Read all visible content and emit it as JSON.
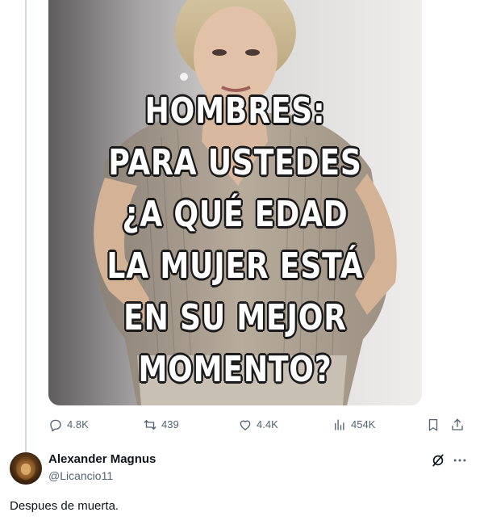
{
  "meme": {
    "lines": [
      "HOMBRES:",
      "PARA USTEDES",
      "¿A QUÉ EDAD",
      "LA MUJER ESTÁ",
      "EN SU MEJOR",
      "MOMENTO?"
    ]
  },
  "actions": {
    "replies": "4.8K",
    "reposts": "439",
    "likes": "4.4K",
    "views": "454K"
  },
  "reply": {
    "name": "Alexander Magnus",
    "handle": "@Licancio11",
    "text": "Despues de muerta."
  }
}
